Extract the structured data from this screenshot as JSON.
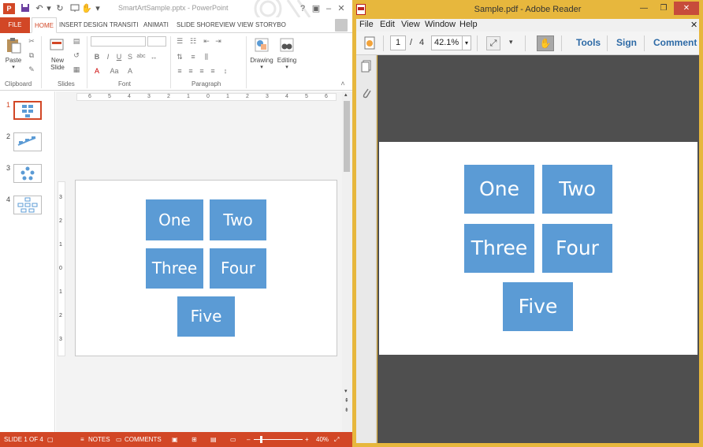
{
  "powerpoint": {
    "window_title": "SmartArtSample.pptx - PowerPoint",
    "app_icon": "P",
    "tabs": [
      "FILE",
      "HOME",
      "INSERT",
      "DESIGN",
      "TRANSITI",
      "ANIMATI",
      "SLIDE SHO",
      "REVIEW",
      "VIEW",
      "STORYBO"
    ],
    "active_tab": "HOME",
    "ribbon": {
      "paste_label": "Paste",
      "new_slide_label": "New",
      "new_slide_label2": "Slide",
      "drawing_label": "Drawing",
      "editing_label": "Editing",
      "groups": [
        "Clipboard",
        "Slides",
        "Font",
        "Paragraph"
      ]
    },
    "thumbnails": [
      {
        "num": "1",
        "active": true
      },
      {
        "num": "2",
        "active": false
      },
      {
        "num": "3",
        "active": false
      },
      {
        "num": "4",
        "active": false
      }
    ],
    "ruler_labels": [
      "6",
      "5",
      "4",
      "3",
      "2",
      "1",
      "0",
      "1",
      "2",
      "3",
      "4",
      "5",
      "6"
    ],
    "vruler_labels": [
      "3",
      "2",
      "1",
      "0",
      "1",
      "2",
      "3"
    ],
    "slide_boxes": [
      "One",
      "Two",
      "Three",
      "Four",
      "Five"
    ],
    "status": {
      "slide_info": "SLIDE 1 OF 4",
      "notes": "NOTES",
      "comments": "COMMENTS",
      "zoom": "40%"
    },
    "colors": {
      "accent": "#d24726",
      "smartart": "#5b9bd5"
    }
  },
  "reader": {
    "window_title": "Sample.pdf - Adobe Reader",
    "menu": [
      "File",
      "Edit",
      "View",
      "Window",
      "Help"
    ],
    "page_current": "1",
    "page_separator": "/",
    "page_total": "4",
    "zoom": "42.1%",
    "tools": [
      "Tools",
      "Sign",
      "Comment"
    ],
    "pdf_boxes": [
      "One",
      "Two",
      "Three",
      "Four",
      "Five"
    ],
    "colors": {
      "frame": "#e7b73d",
      "link": "#2d6aa6"
    }
  }
}
